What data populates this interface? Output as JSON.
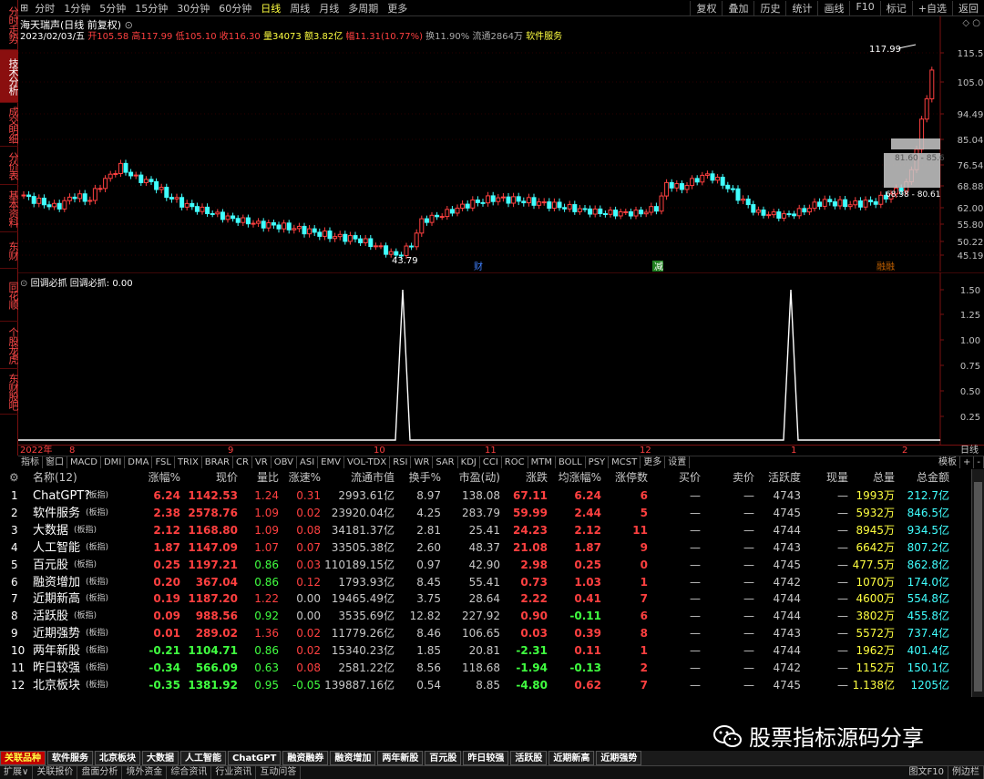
{
  "left_tabs": [
    "分时走势",
    "技术分析",
    "成交明细",
    "分价表",
    "基本资料",
    "东财",
    "同花顺",
    "个股龙虎",
    "东财股吧"
  ],
  "top_tabs": [
    "分时",
    "1分钟",
    "5分钟",
    "15分钟",
    "30分钟",
    "60分钟",
    "日线",
    "周线",
    "月线",
    "多周期",
    "更多"
  ],
  "top_right": [
    "复权",
    "叠加",
    "历史",
    "统计",
    "画线",
    "F10",
    "标记",
    "+自选",
    "返回"
  ],
  "stock_title": "海天瑞声(日线 前复权)",
  "info": {
    "date": "2023/02/03/五",
    "open": "开105.58",
    "high": "高117.99",
    "low": "低105.10",
    "close": "收116.30",
    "vol": "量34073",
    "amt": "额3.82亿",
    "change": "幅11.31(10.77%)",
    "turnover": "换11.90%",
    "float": "流通2864万",
    "sector": "软件服务"
  },
  "price_axis": [
    "115.5",
    "105.0",
    "94.49",
    "85.04",
    "76.54",
    "68.88",
    "62.00",
    "55.80",
    "50.22",
    "45.19"
  ],
  "price_labels": {
    "high": "117.99",
    "low": "43.79",
    "box_top": "81.60 - 85.6",
    "box_bot": "68.98 - 80.61"
  },
  "events": [
    "财",
    "减",
    "融融"
  ],
  "indicator": {
    "name": "回调必抓",
    "label": "回调必抓: 0.00",
    "axis": [
      "1.50",
      "1.25",
      "1.00",
      "0.75",
      "0.50",
      "0.25"
    ],
    "spikes": [
      0,
      1.5
    ]
  },
  "time_axis": [
    "2022年",
    "8",
    "9",
    "10",
    "11",
    "12",
    "1",
    "2"
  ],
  "time_axis_right": "日线",
  "ind_tabs": [
    "指标",
    "窗口",
    "MACD",
    "DMI",
    "DMA",
    "FSL",
    "TRIX",
    "BRAR",
    "CR",
    "VR",
    "OBV",
    "ASI",
    "EMV",
    "VOL-TDX",
    "RSI",
    "WR",
    "SAR",
    "KDJ",
    "CCI",
    "ROC",
    "MTM",
    "BOLL",
    "PSY",
    "MCST",
    "更多",
    "设置"
  ],
  "ind_right": [
    "模板",
    "+",
    "-"
  ],
  "table": {
    "headers": [
      "名称(12)",
      "涨幅%",
      "现价",
      "量比",
      "涨速%",
      "流通市值",
      "换手%",
      "市盈(动)",
      "涨跌",
      "均涨幅%",
      "涨停数",
      "买价",
      "卖价",
      "活跃度",
      "现量",
      "总量",
      "总金额"
    ],
    "rows": [
      [
        "1",
        "ChatGPT?",
        "6.24",
        "1142.53",
        "1.24",
        "0.31",
        "2993.61亿",
        "8.97",
        "138.08",
        "67.11",
        "6.24",
        "6",
        "—",
        "—",
        "4743",
        "—",
        "1993万",
        "212.7亿"
      ],
      [
        "2",
        "软件服务",
        "2.38",
        "2578.76",
        "1.09",
        "0.02",
        "23920.04亿",
        "4.25",
        "283.79",
        "59.99",
        "2.44",
        "5",
        "—",
        "—",
        "4745",
        "—",
        "5932万",
        "846.5亿"
      ],
      [
        "3",
        "大数据",
        "2.12",
        "1168.80",
        "1.09",
        "0.08",
        "34181.37亿",
        "2.81",
        "25.41",
        "24.23",
        "2.12",
        "11",
        "—",
        "—",
        "4744",
        "—",
        "8945万",
        "934.5亿"
      ],
      [
        "4",
        "人工智能",
        "1.87",
        "1147.09",
        "1.07",
        "0.07",
        "33505.38亿",
        "2.60",
        "48.37",
        "21.08",
        "1.87",
        "9",
        "—",
        "—",
        "4743",
        "—",
        "6642万",
        "807.2亿"
      ],
      [
        "5",
        "百元股",
        "0.25",
        "1197.21",
        "0.86",
        "0.03",
        "110189.15亿",
        "0.97",
        "42.90",
        "2.98",
        "0.25",
        "0",
        "—",
        "—",
        "4745",
        "—",
        "477.5万",
        "862.8亿"
      ],
      [
        "6",
        "融资增加",
        "0.20",
        "367.04",
        "0.86",
        "0.12",
        "1793.93亿",
        "8.45",
        "55.41",
        "0.73",
        "1.03",
        "1",
        "—",
        "—",
        "4742",
        "—",
        "1070万",
        "174.0亿"
      ],
      [
        "7",
        "近期新高",
        "0.19",
        "1187.20",
        "1.22",
        "0.00",
        "19465.49亿",
        "3.75",
        "28.64",
        "2.22",
        "0.41",
        "7",
        "—",
        "—",
        "4744",
        "—",
        "4600万",
        "554.8亿"
      ],
      [
        "8",
        "活跃股",
        "0.09",
        "988.56",
        "0.92",
        "0.00",
        "3535.69亿",
        "12.82",
        "227.92",
        "0.90",
        "-0.11",
        "6",
        "—",
        "—",
        "4744",
        "—",
        "3802万",
        "455.8亿"
      ],
      [
        "9",
        "近期强势",
        "0.01",
        "289.02",
        "1.36",
        "0.02",
        "11779.26亿",
        "8.46",
        "106.65",
        "0.03",
        "0.39",
        "8",
        "—",
        "—",
        "4743",
        "—",
        "5572万",
        "737.4亿"
      ],
      [
        "10",
        "两年新股",
        "-0.21",
        "1104.71",
        "0.86",
        "0.02",
        "15340.23亿",
        "1.85",
        "20.81",
        "-2.31",
        "0.11",
        "1",
        "—",
        "—",
        "4744",
        "—",
        "1962万",
        "401.4亿"
      ],
      [
        "11",
        "昨日较强",
        "-0.34",
        "566.09",
        "0.63",
        "0.08",
        "2581.22亿",
        "8.56",
        "118.68",
        "-1.94",
        "-0.13",
        "2",
        "—",
        "—",
        "4742",
        "—",
        "1152万",
        "150.1亿"
      ],
      [
        "12",
        "北京板块",
        "-0.35",
        "1381.92",
        "0.95",
        "-0.05",
        "139887.16亿",
        "0.54",
        "8.85",
        "-4.80",
        "0.62",
        "7",
        "—",
        "—",
        "4745",
        "—",
        "1.138亿",
        "1205亿"
      ]
    ],
    "tag": "(板指)"
  },
  "bottom_tabs": [
    "关联品种",
    "软件服务",
    "北京板块",
    "大数据",
    "人工智能",
    "ChatGPT",
    "融资融券",
    "融资增加",
    "两年新股",
    "百元股",
    "昨日较强",
    "活跃股",
    "近期新高",
    "近期强势"
  ],
  "status_bar": [
    "扩展∨",
    "关联报价",
    "盘面分析",
    "境外资金",
    "综合资讯",
    "行业资讯",
    "互动问答"
  ],
  "status_right": [
    "图文F10",
    "例边栏"
  ],
  "watermark": "股票指标源码分享",
  "chart_data": {
    "type": "line",
    "candles": "daily price candlestick",
    "indicator_values": [
      0,
      1.5
    ]
  },
  "colors": {
    "up": "#ff4040",
    "down": "#40ffff",
    "accent": "#c00000"
  }
}
